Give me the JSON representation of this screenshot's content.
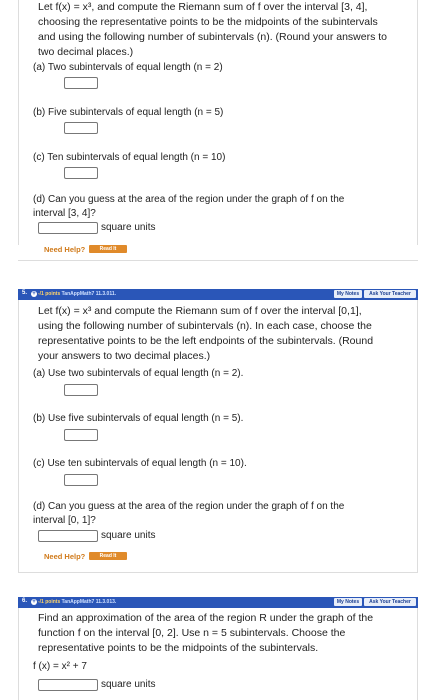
{
  "q4": {
    "statement_lines": [
      "Let f(x) = x³, and compute the Riemann sum of f over the interval [3, 4],",
      "choosing the representative points to be the midpoints of the subintervals",
      "and using the following number of subintervals (n). (Round your answers to",
      "two decimal places.)"
    ],
    "parts": [
      "(a) Two subintervals of equal length (n = 2)",
      "(b) Five subintervals of equal length (n = 5)",
      "(c) Ten subintervals of equal length (n = 10)"
    ],
    "part_d_lines": [
      "(d) Can you guess at the area of the region under the graph of f on the",
      "interval [3, 4]?"
    ],
    "units": "square units",
    "need_help": "Need Help?",
    "read_it": "Read It"
  },
  "q5": {
    "number": "5.",
    "points": "-/1 points",
    "source": "TanAppMath7 11.3.011.",
    "my_notes": "My Notes",
    "ask_teacher": "Ask Your Teacher",
    "statement_lines": [
      "Let f(x) = x³ and compute the Riemann sum of f over the interval [0,1],",
      "using the following number of subintervals (n). In each case, choose the",
      "representative points to be the left endpoints of the subintervals. (Round",
      "your answers to two decimal places.)"
    ],
    "parts": [
      "(a) Use two subintervals of equal length (n = 2).",
      "(b) Use five subintervals of equal length (n = 5).",
      "(c) Use ten subintervals of equal length (n = 10)."
    ],
    "part_d_lines": [
      "(d) Can you guess at the area of the region under the graph of f on the",
      "interval [0, 1]?"
    ],
    "units": "square units",
    "need_help": "Need Help?",
    "read_it": "Read It"
  },
  "q6": {
    "number": "6.",
    "points": "-/1 points",
    "source": "TanAppMath7 11.3.013.",
    "my_notes": "My Notes",
    "ask_teacher": "Ask Your Teacher",
    "statement_lines": [
      "Find an approximation of the area of the region R under the graph of the",
      "function f on the interval [0, 2]. Use n = 5 subintervals. Choose the",
      "representative points to be the midpoints of the subintervals."
    ],
    "function": "f (x) = x² + 7",
    "units": "square units"
  }
}
